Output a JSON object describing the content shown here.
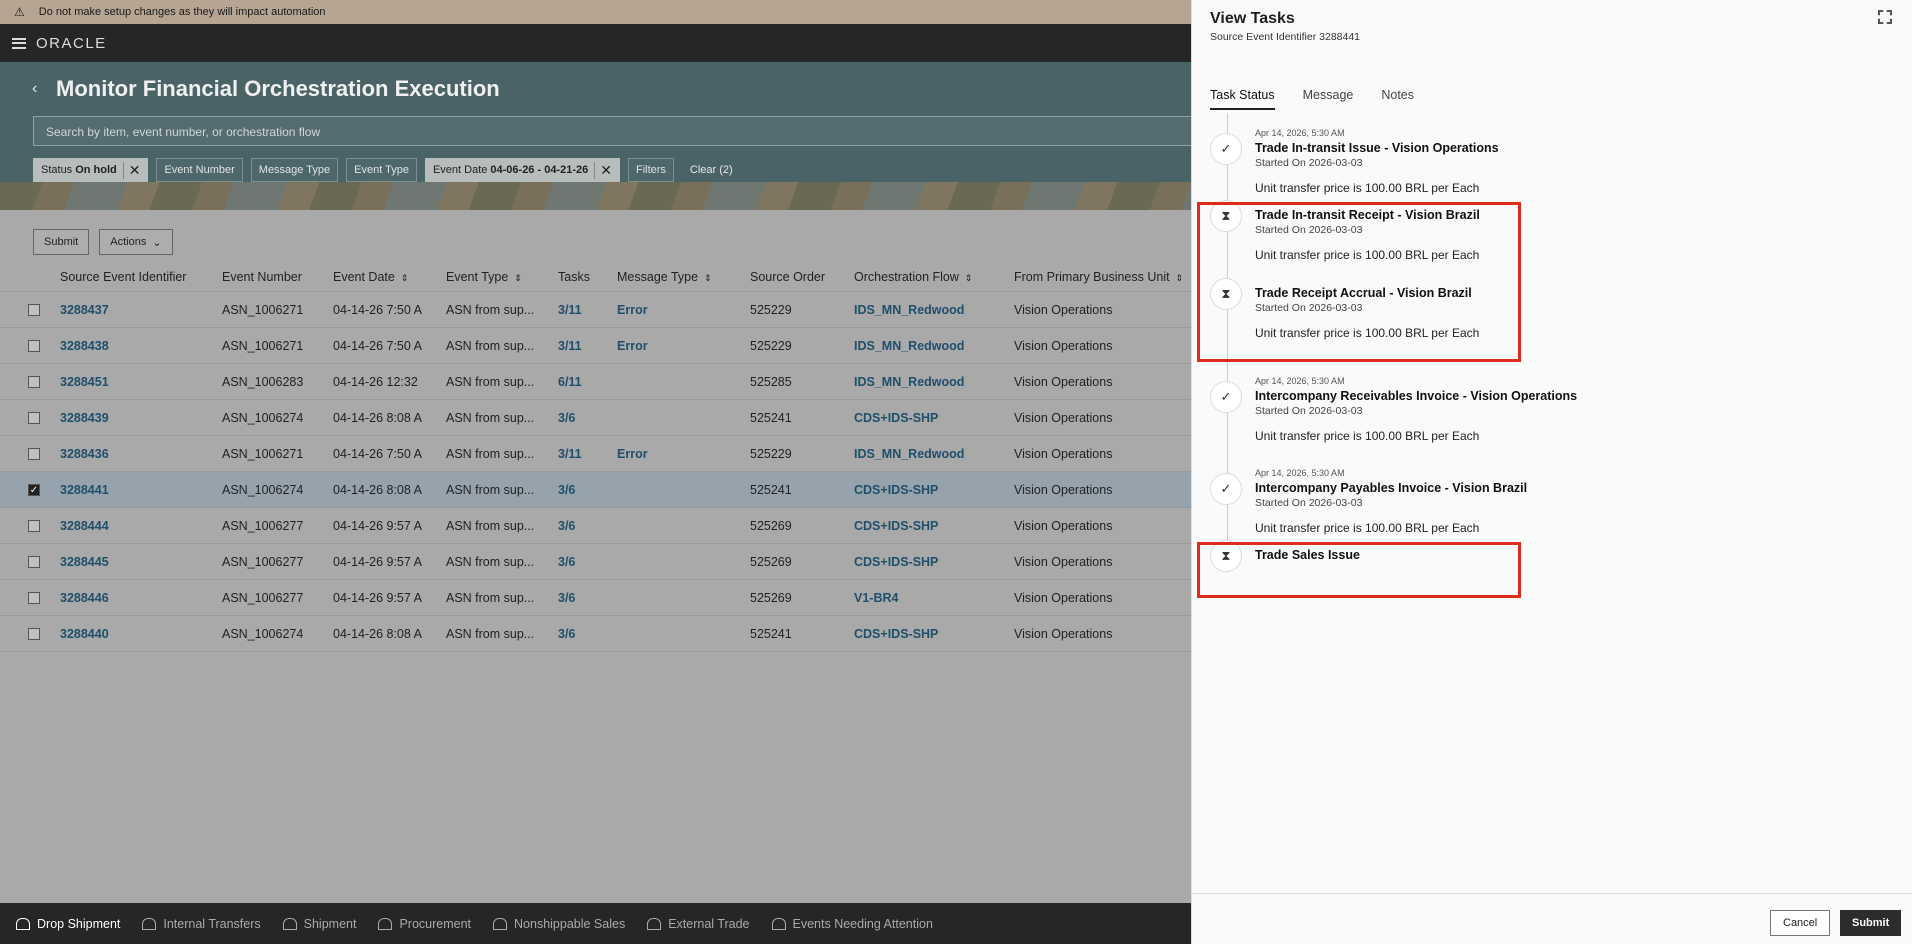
{
  "banner": {
    "text": "Do not make setup changes as they will impact automation"
  },
  "app": {
    "logo": "ORACLE"
  },
  "page": {
    "title": "Monitor Financial Orchestration Execution",
    "search_placeholder": "Search by item, event number, or orchestration flow"
  },
  "filters": {
    "status_label": "Status",
    "status_value": "On hold",
    "event_number": "Event Number",
    "message_type": "Message Type",
    "event_type": "Event Type",
    "event_date_label": "Event Date",
    "event_date_value": "04-06-26 - 04-21-26",
    "filters": "Filters",
    "clear": "Clear (2)"
  },
  "toolbar": {
    "submit": "Submit",
    "actions": "Actions"
  },
  "table": {
    "headers": [
      "Source Event Identifier",
      "Event Number",
      "Event Date",
      "Event Type",
      "Tasks",
      "Message Type",
      "Source Order",
      "Orchestration Flow",
      "From Primary Business Unit"
    ],
    "rows": [
      {
        "id": "3288437",
        "num": "ASN_1006271",
        "date": "04-14-26 7:50 A",
        "type": "ASN from sup...",
        "tasks": "3/11",
        "msg": "Error",
        "order": "525229",
        "flow": "IDS_MN_Redwood",
        "bu": "Vision Operations",
        "checked": false
      },
      {
        "id": "3288438",
        "num": "ASN_1006271",
        "date": "04-14-26 7:50 A",
        "type": "ASN from sup...",
        "tasks": "3/11",
        "msg": "Error",
        "order": "525229",
        "flow": "IDS_MN_Redwood",
        "bu": "Vision Operations",
        "checked": false
      },
      {
        "id": "3288451",
        "num": "ASN_1006283",
        "date": "04-14-26 12:32",
        "type": "ASN from sup...",
        "tasks": "6/11",
        "msg": "",
        "order": "525285",
        "flow": "IDS_MN_Redwood",
        "bu": "Vision Operations",
        "checked": false
      },
      {
        "id": "3288439",
        "num": "ASN_1006274",
        "date": "04-14-26 8:08 A",
        "type": "ASN from sup...",
        "tasks": "3/6",
        "msg": "",
        "order": "525241",
        "flow": "CDS+IDS-SHP",
        "bu": "Vision Operations",
        "checked": false
      },
      {
        "id": "3288436",
        "num": "ASN_1006271",
        "date": "04-14-26 7:50 A",
        "type": "ASN from sup...",
        "tasks": "3/11",
        "msg": "Error",
        "order": "525229",
        "flow": "IDS_MN_Redwood",
        "bu": "Vision Operations",
        "checked": false
      },
      {
        "id": "3288441",
        "num": "ASN_1006274",
        "date": "04-14-26 8:08 A",
        "type": "ASN from sup...",
        "tasks": "3/6",
        "msg": "",
        "order": "525241",
        "flow": "CDS+IDS-SHP",
        "bu": "Vision Operations",
        "checked": true
      },
      {
        "id": "3288444",
        "num": "ASN_1006277",
        "date": "04-14-26 9:57 A",
        "type": "ASN from sup...",
        "tasks": "3/6",
        "msg": "",
        "order": "525269",
        "flow": "CDS+IDS-SHP",
        "bu": "Vision Operations",
        "checked": false
      },
      {
        "id": "3288445",
        "num": "ASN_1006277",
        "date": "04-14-26 9:57 A",
        "type": "ASN from sup...",
        "tasks": "3/6",
        "msg": "",
        "order": "525269",
        "flow": "CDS+IDS-SHP",
        "bu": "Vision Operations",
        "checked": false
      },
      {
        "id": "3288446",
        "num": "ASN_1006277",
        "date": "04-14-26 9:57 A",
        "type": "ASN from sup...",
        "tasks": "3/6",
        "msg": "",
        "order": "525269",
        "flow": "V1-BR4",
        "bu": "Vision Operations",
        "checked": false
      },
      {
        "id": "3288440",
        "num": "ASN_1006274",
        "date": "04-14-26 8:08 A",
        "type": "ASN from sup...",
        "tasks": "3/6",
        "msg": "",
        "order": "525241",
        "flow": "CDS+IDS-SHP",
        "bu": "Vision Operations",
        "checked": false
      }
    ]
  },
  "footer_tabs": [
    "Drop Shipment",
    "Internal Transfers",
    "Shipment",
    "Procurement",
    "Nonshippable Sales",
    "External Trade",
    "Events Needing Attention"
  ],
  "panel": {
    "title": "View Tasks",
    "subtitle": "Source Event Identifier 3288441",
    "tabs": [
      "Task Status",
      "Message",
      "Notes"
    ],
    "tasks": [
      {
        "time": "Apr 14, 2026, 5:30 AM",
        "name": "Trade In-transit Issue - Vision Operations",
        "started": "Started On 2026-03-03",
        "note": "Unit transfer price is 100.00 BRL per Each",
        "status": "done"
      },
      {
        "time": "",
        "name": "Trade In-transit Receipt - Vision Brazil",
        "started": "Started On 2026-03-03",
        "note": "Unit transfer price is 100.00 BRL per Each",
        "status": "pending"
      },
      {
        "time": "",
        "name": "Trade Receipt Accrual - Vision Brazil",
        "started": "Started On 2026-03-03",
        "note": "Unit transfer price is 100.00 BRL per Each",
        "status": "pending"
      },
      {
        "time": "Apr 14, 2026, 5:30 AM",
        "name": "Intercompany Receivables Invoice - Vision Operations",
        "started": "Started On 2026-03-03",
        "note": "Unit transfer price is 100.00 BRL per Each",
        "status": "done"
      },
      {
        "time": "Apr 14, 2026, 5:30 AM",
        "name": "Intercompany Payables Invoice - Vision Brazil",
        "started": "Started On 2026-03-03",
        "note": "Unit transfer price is 100.00 BRL per Each",
        "status": "done"
      },
      {
        "time": "",
        "name": "Trade Sales Issue",
        "started": "",
        "note": "",
        "status": "pending"
      }
    ],
    "cancel": "Cancel",
    "submit": "Submit"
  },
  "colors": {
    "highlight": "#e02a1c",
    "link": "#1f4f6b",
    "selected_row": "#96a3ac"
  }
}
